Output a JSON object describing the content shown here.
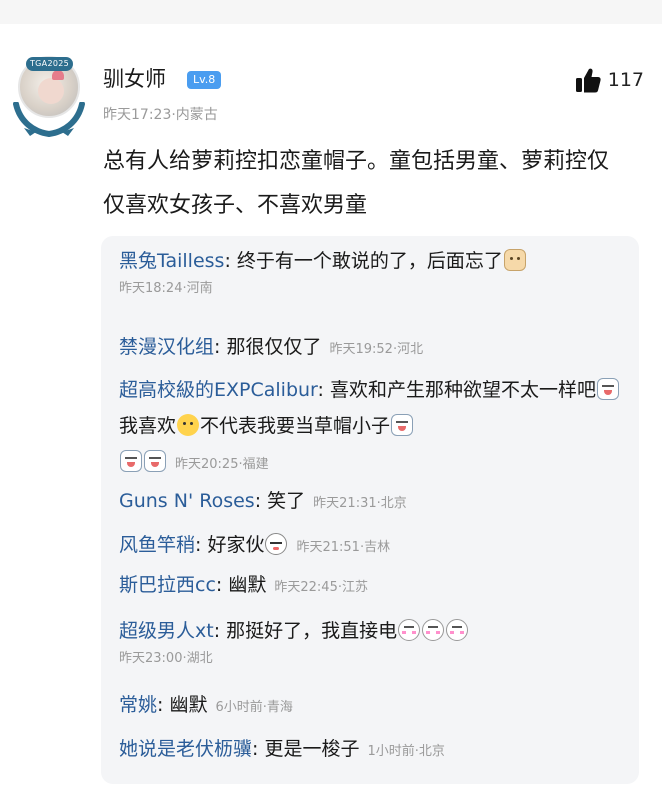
{
  "comment": {
    "avatar_badge": "TGA2025",
    "username": "驯女师",
    "level": "Lv.8",
    "timestamp": "昨天17:23·内蒙古",
    "like_count": "117",
    "text": "总有人给萝莉控扣恋童帽子。童包括男童、萝莉控仅仅喜欢女孩子、不喜欢男童"
  },
  "replies": [
    {
      "author": "黑兔Tailless",
      "text": "终于有一个敢说的了，后面忘了",
      "emojis_after": [
        "cat-face-icon"
      ],
      "meta": "昨天18:24·河南"
    },
    {
      "author": "禁漫汉化组",
      "text": "那很仅仅了",
      "meta": "昨天19:52·河北"
    },
    {
      "author": "超高校級的EXPCalibur",
      "text_part1": "喜欢和产生那种欲望不太一样吧",
      "text_part2": "我喜欢",
      "text_part3": "不代表我要当草帽小子",
      "meta": "昨天20:25·福建"
    },
    {
      "author": "Guns N' Roses",
      "text": "笑了",
      "meta": "昨天21:31·北京"
    },
    {
      "author": "风鱼竿稍",
      "text": "好家伙",
      "meta": "昨天21:51·吉林"
    },
    {
      "author": "斯巴拉西cc",
      "text": "幽默",
      "meta": "昨天22:45·江苏"
    },
    {
      "author": "超级男人xt",
      "text": "那挺好了，我直接电",
      "meta": "昨天23:00·湖北"
    },
    {
      "author": "常姚",
      "text": "幽默",
      "meta": "6小时前·青海"
    },
    {
      "author": "她说是老伏枥骥",
      "text": "更是一梭子",
      "meta": "1小时前·北京"
    }
  ],
  "colors": {
    "author": "#2b5d99",
    "level_badge": "#4a9df0",
    "reply_bg": "#f4f5f7"
  }
}
